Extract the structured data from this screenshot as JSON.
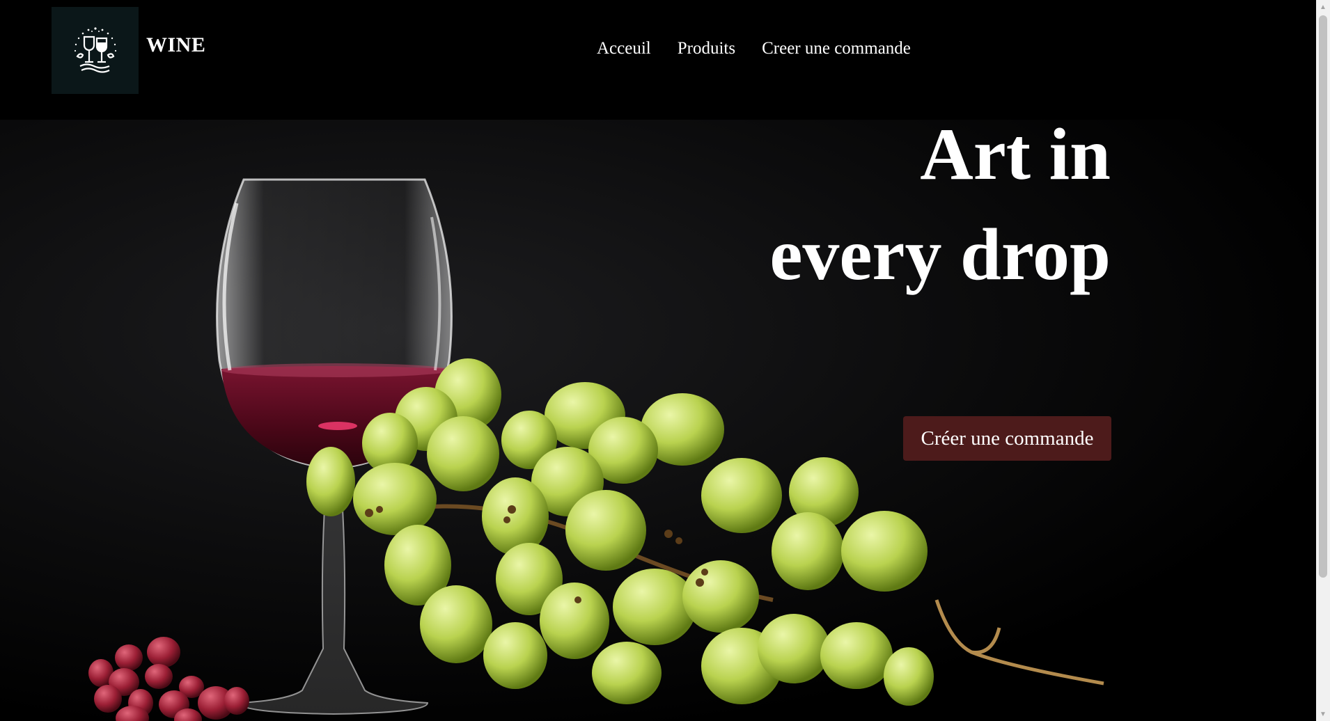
{
  "header": {
    "logo_icon": "wine-glass-vineyard-logo",
    "brand": "WINE",
    "nav": [
      {
        "label": "Acceuil"
      },
      {
        "label": "Produits"
      },
      {
        "label": "Creer une commande"
      }
    ]
  },
  "hero": {
    "title_line1": "Art in",
    "title_line2": "every drop",
    "cta_label": "Créer une commande",
    "image": "wine-glass-and-grapes"
  },
  "colors": {
    "background": "#000000",
    "logo_bg": "#0b1719",
    "cta_bg": "#4d1b1b",
    "wine": "#6a0f24",
    "grape_green": "#c7df5f",
    "grape_red": "#a3213a"
  }
}
